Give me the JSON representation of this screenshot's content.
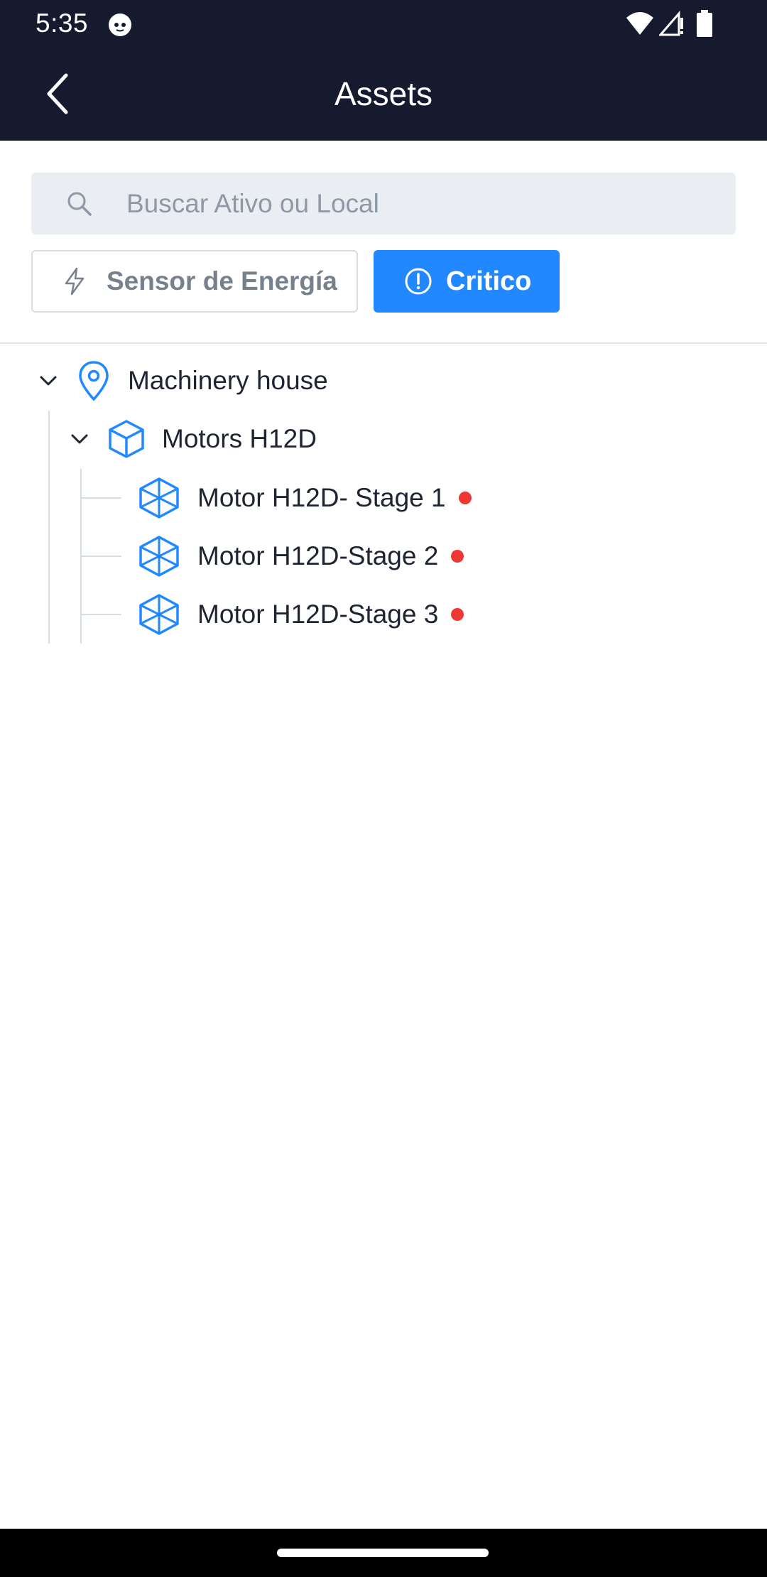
{
  "status_bar": {
    "time": "5:35"
  },
  "header": {
    "title": "Assets"
  },
  "search": {
    "placeholder": "Buscar Ativo ou Local"
  },
  "filters": {
    "energy_label": "Sensor de Energía",
    "critical_label": "Critico",
    "critical_active": true
  },
  "tree": {
    "location": {
      "label": "Machinery house",
      "expanded": true
    },
    "group": {
      "label": "Motors H12D",
      "expanded": true
    },
    "components": [
      {
        "label": "Motor H12D- Stage 1",
        "status": "critical"
      },
      {
        "label": "Motor H12D-Stage 2",
        "status": "critical"
      },
      {
        "label": "Motor H12D-Stage 3",
        "status": "critical"
      }
    ]
  },
  "colors": {
    "header_bg": "#151a2e",
    "accent_blue": "#2188ff",
    "critical_red": "#ed3833",
    "tree_line": "#d6dde5"
  }
}
